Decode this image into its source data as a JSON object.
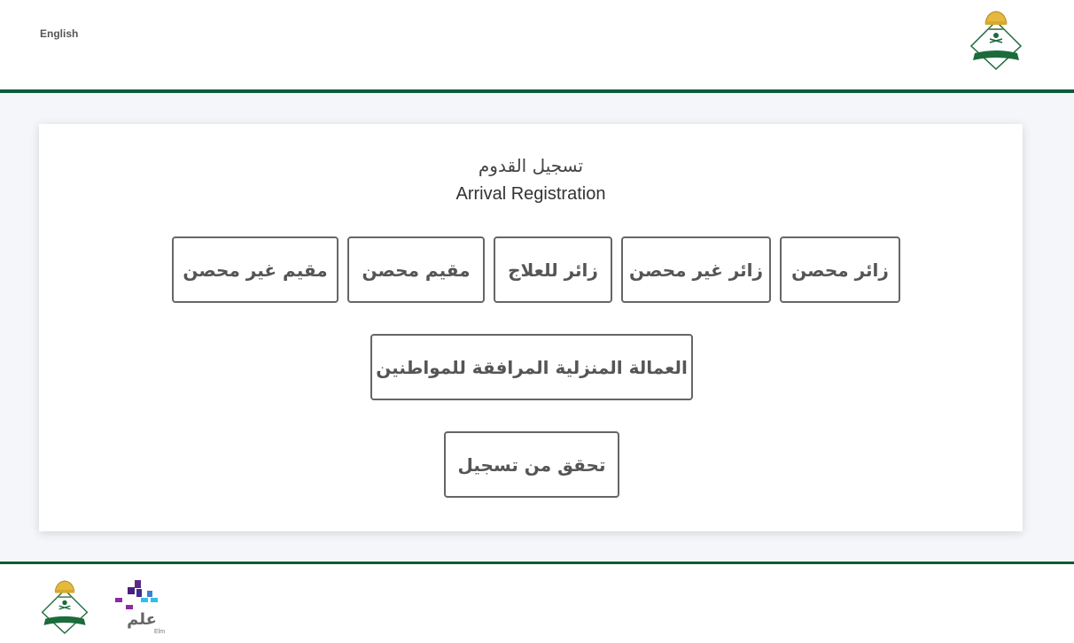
{
  "header": {
    "language_link": "English",
    "logo": "passports-emblem-icon"
  },
  "page": {
    "title_ar": "تسجيل القدوم",
    "title_en": "Arrival Registration"
  },
  "buttons": [
    {
      "id": "vaccinated-visitor",
      "label": "زائر محصن"
    },
    {
      "id": "unvaccinated-visitor",
      "label": "زائر غير محصن"
    },
    {
      "id": "medical-visitor",
      "label": "زائر للعلاج"
    },
    {
      "id": "vaccinated-resident",
      "label": "مقيم محصن"
    },
    {
      "id": "unvaccinated-resident",
      "label": "مقيم غير محصن"
    },
    {
      "id": "domestic-workers",
      "label": "العمالة المنزلية المرافقة للمواطنين"
    },
    {
      "id": "verify-registration",
      "label": "تحقق من تسجيل"
    }
  ],
  "footer": {
    "logos": [
      "passports-emblem-icon",
      "elm-logo-icon"
    ],
    "elm_text_ar": "علم",
    "elm_text_en": "Elm"
  },
  "colors": {
    "brand_green": "#0b5c3a",
    "background": "#f4f6fa"
  }
}
